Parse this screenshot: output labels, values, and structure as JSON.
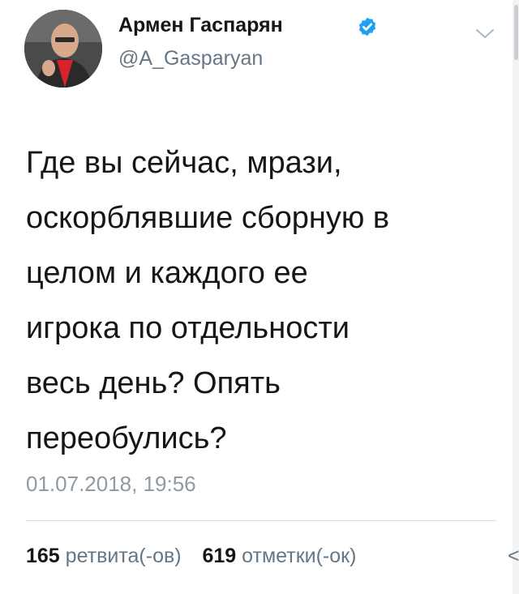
{
  "tweet": {
    "author": {
      "display_name": "Армен Гаспарян",
      "handle": "@A_Gasparyan",
      "verified": true,
      "avatar_icon": "profile-photo"
    },
    "menu_icon": "chevron-down-icon",
    "text_lines": [
      "Где вы сейчас, мрази,",
      "оскорблявшие сборную в",
      "целом и каждого ее",
      "игрока по отдельности",
      "весь день? Опять",
      "переобулись?"
    ],
    "timestamp": "01.07.2018, 19:56",
    "stats": {
      "retweets_count": "165",
      "retweets_label": "ретвита(-ов)",
      "likes_count": "619",
      "likes_label": "отметки(-ок)",
      "overflow_glyph": "<"
    }
  },
  "colors": {
    "verified_badge": "#1da1f2",
    "secondary_text": "#657786",
    "timestamp_text": "#8e9aa6"
  }
}
